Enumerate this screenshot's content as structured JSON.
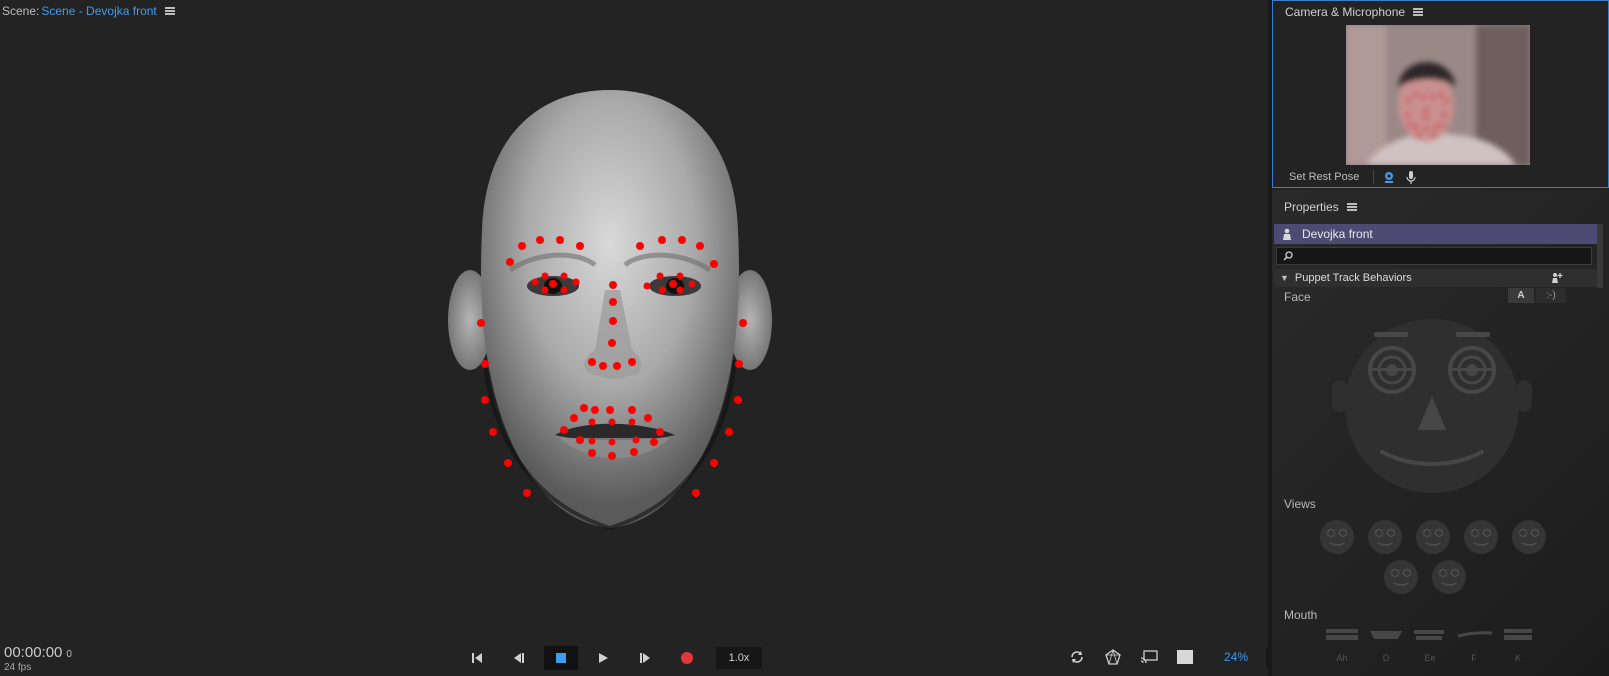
{
  "scene": {
    "label": "Scene:",
    "name": "Scene - Devojka front",
    "timecode": "00:00:00",
    "frame": "0",
    "fps": "24 fps",
    "speed": "1.0x",
    "zoom": "24%",
    "stop_color": "#3d9bf0",
    "record_color": "#e43737"
  },
  "camera": {
    "title": "Camera & Microphone",
    "set_rest_pose": "Set Rest Pose"
  },
  "properties": {
    "title": "Properties",
    "puppet_name": "Devojka front",
    "search_placeholder": "",
    "section": "Puppet Track Behaviors",
    "face_label": "Face",
    "face_btn_a": "A",
    "face_btn_smile": ":-)",
    "views_label": "Views",
    "mouth_label": "Mouth",
    "mouth_shapes": [
      "Ah",
      "D",
      "Ee",
      "F",
      "K"
    ]
  },
  "icons": {
    "hamburger": "menu-icon",
    "webcam": "webcam-icon",
    "microphone": "microphone-icon"
  },
  "colors": {
    "accent": "#3d9bf0",
    "puppet_bar": "#4d4a73",
    "tracking_dots": "#ff0000"
  }
}
